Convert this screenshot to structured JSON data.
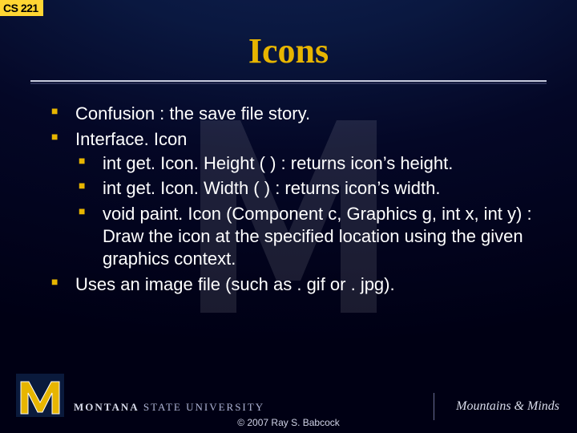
{
  "course": "CS 221",
  "title": "Icons",
  "bullets": {
    "b1": "Confusion : the save file story.",
    "b2": "Interface. Icon",
    "b2_1": "int get. Icon. Height ( ) : returns icon’s height.",
    "b2_2": "int get. Icon. Width ( ) : returns icon’s width.",
    "b2_3": "void paint. Icon (Component c, Graphics g, int x, int y) : Draw the icon at the specified location using the given graphics context.",
    "b3": "Uses an image file (such as . gif or . jpg)."
  },
  "footer": {
    "university_bold": "MONTANA",
    "university_light": "STATE UNIVERSITY",
    "tagline": "Mountains & Minds",
    "copyright": "© 2007 Ray S. Babcock"
  }
}
